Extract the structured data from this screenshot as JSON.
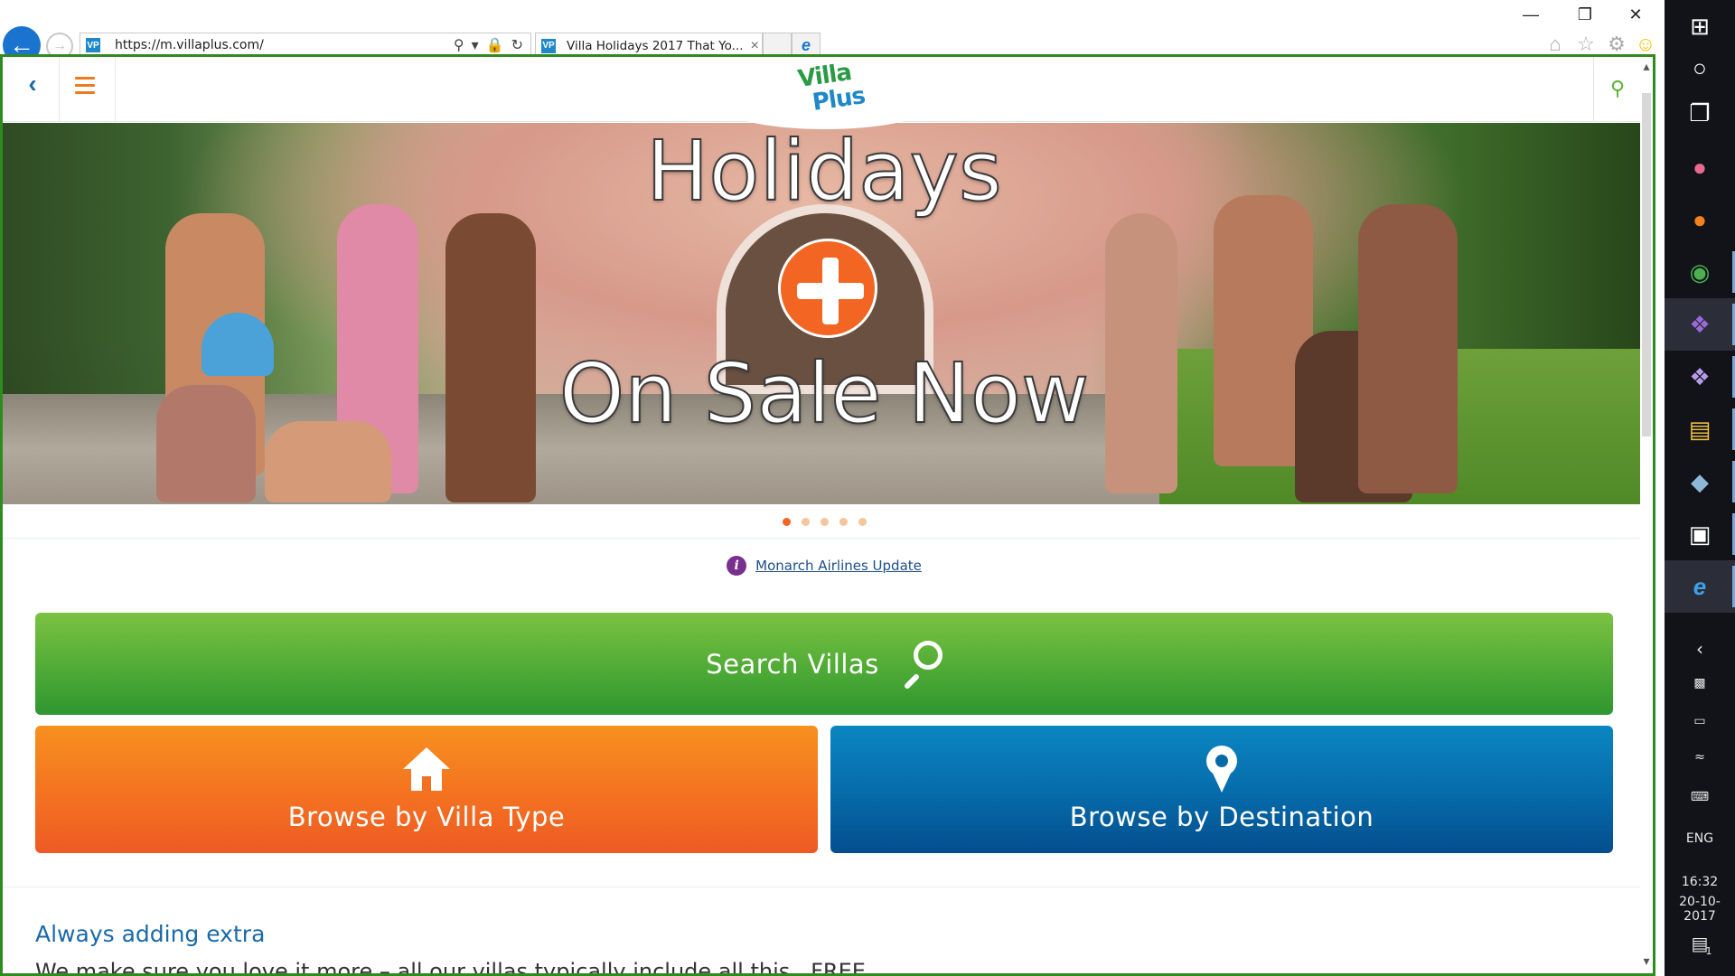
{
  "browser": {
    "url": "https://m.villaplus.com/",
    "tab_title": "Villa Holidays 2017 That Yo...",
    "favicon_text": "VP",
    "window_controls": {
      "minimize": "—",
      "restore": "❐",
      "close": "✕"
    }
  },
  "site_header": {
    "logo_line1": "Villa",
    "logo_line2": "Plus"
  },
  "hero": {
    "title": "Holidays",
    "subtitle": "On Sale Now",
    "slides_total": 5,
    "active_slide": 1,
    "accent": "#f26522"
  },
  "notice": {
    "icon": "i",
    "link_text": "Monarch Airlines Update"
  },
  "actions": {
    "search_label": "Search Villas",
    "browse_type_label": "Browse by Villa Type",
    "browse_destination_label": "Browse by Destination",
    "colors": {
      "search": "#4fab36",
      "type": "#f36f21",
      "destination": "#066aa9"
    }
  },
  "section": {
    "heading": "Always adding extra",
    "body": "We make sure you love it more – all our villas typically include all this...FREE"
  },
  "taskbar": {
    "language": "ENG",
    "time": "16:32",
    "date": "20-10-2017",
    "notification_count": "1",
    "items": [
      "windows-icon",
      "cortana-icon",
      "task-view-icon",
      "paint-icon",
      "firefox-icon",
      "chrome-icon",
      "visual-studio-icon",
      "vs-installer-icon",
      "file-explorer-icon",
      "app-icon",
      "console-icon",
      "internet-explorer-icon"
    ]
  }
}
